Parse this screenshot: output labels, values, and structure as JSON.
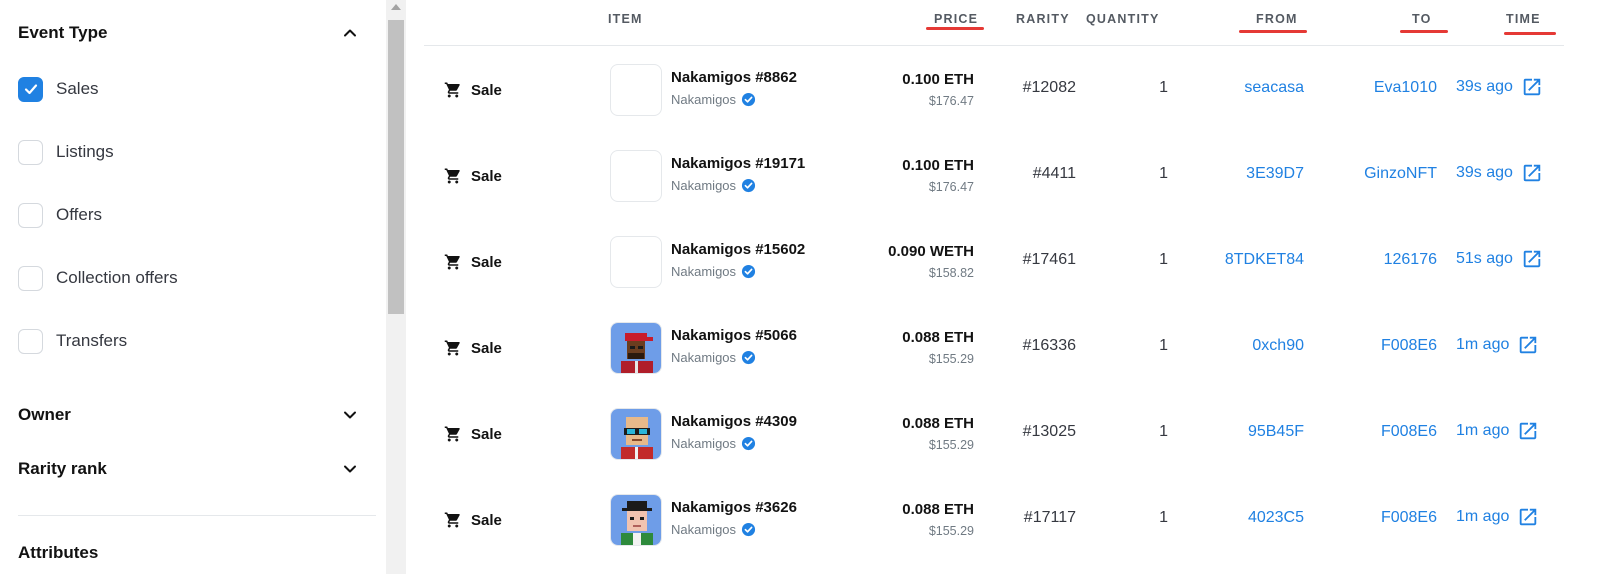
{
  "sidebar": {
    "event_type_title": "Event Type",
    "filters": [
      {
        "label": "Sales",
        "checked": true
      },
      {
        "label": "Listings",
        "checked": false
      },
      {
        "label": "Offers",
        "checked": false
      },
      {
        "label": "Collection offers",
        "checked": false
      },
      {
        "label": "Transfers",
        "checked": false
      }
    ],
    "sections": [
      {
        "label": "Owner"
      },
      {
        "label": "Rarity rank"
      },
      {
        "label": "Attributes"
      }
    ]
  },
  "table": {
    "headers": {
      "item": "ITEM",
      "price": "PRICE",
      "rarity": "RARITY",
      "quantity": "QUANTITY",
      "from": "FROM",
      "to": "TO",
      "time": "TIME"
    },
    "rows": [
      {
        "event": "Sale",
        "name": "Nakamigos #8862",
        "collection": "Nakamigos",
        "price": "0.100 ETH",
        "usd": "$176.47",
        "rarity": "#12082",
        "quantity": "1",
        "from": "seacasa",
        "to": "Eva1010",
        "time": "39s ago",
        "avatar": "blank"
      },
      {
        "event": "Sale",
        "name": "Nakamigos #19171",
        "collection": "Nakamigos",
        "price": "0.100 ETH",
        "usd": "$176.47",
        "rarity": "#4411",
        "quantity": "1",
        "from": "3E39D7",
        "to": "GinzoNFT",
        "time": "39s ago",
        "avatar": "blank"
      },
      {
        "event": "Sale",
        "name": "Nakamigos #15602",
        "collection": "Nakamigos",
        "price": "0.090 WETH",
        "usd": "$158.82",
        "rarity": "#17461",
        "quantity": "1",
        "from": "8TDKET84",
        "to": "126176",
        "time": "51s ago",
        "avatar": "blank"
      },
      {
        "event": "Sale",
        "name": "Nakamigos #5066",
        "collection": "Nakamigos",
        "price": "0.088 ETH",
        "usd": "$155.29",
        "rarity": "#16336",
        "quantity": "1",
        "from": "0xch90",
        "to": "F008E6",
        "time": "1m ago",
        "avatar": "red-cap"
      },
      {
        "event": "Sale",
        "name": "Nakamigos #4309",
        "collection": "Nakamigos",
        "price": "0.088 ETH",
        "usd": "$155.29",
        "rarity": "#13025",
        "quantity": "1",
        "from": "95B45F",
        "to": "F008E6",
        "time": "1m ago",
        "avatar": "goggles"
      },
      {
        "event": "Sale",
        "name": "Nakamigos #3626",
        "collection": "Nakamigos",
        "price": "0.088 ETH",
        "usd": "$155.29",
        "rarity": "#17117",
        "quantity": "1",
        "from": "4023C5",
        "to": "F008E6",
        "time": "1m ago",
        "avatar": "hat"
      }
    ]
  },
  "colors": {
    "accent": "#2081e2",
    "underline": "#e53935",
    "avatar_bg": "#6e9de8"
  },
  "icons": {
    "event": "cart-icon",
    "verified": "verified-badge-icon",
    "external": "external-link-icon"
  }
}
